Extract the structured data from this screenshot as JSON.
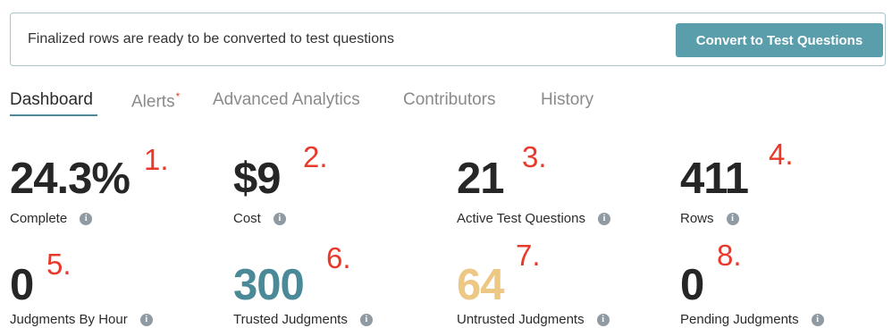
{
  "banner": {
    "message": "Finalized rows are ready to be converted to test questions",
    "button_label": "Convert to Test Questions"
  },
  "tabs": [
    {
      "label": "Dashboard",
      "active": true
    },
    {
      "label": "Alerts",
      "badge": "*"
    },
    {
      "label": "Advanced Analytics"
    },
    {
      "label": "Contributors"
    },
    {
      "label": "History"
    }
  ],
  "stats": [
    {
      "value": "24.3%",
      "label": "Complete",
      "annotation": "1."
    },
    {
      "value": "$9",
      "label": "Cost",
      "annotation": "2."
    },
    {
      "value": "21",
      "label": "Active Test Questions",
      "annotation": "3."
    },
    {
      "value": "411",
      "label": "Rows",
      "annotation": "4."
    },
    {
      "value": "0",
      "label": "Judgments By Hour",
      "annotation": "5."
    },
    {
      "value": "300",
      "label": "Trusted Judgments",
      "annotation": "6.",
      "color": "#4a8a98"
    },
    {
      "value": "64",
      "label": "Untrusted Judgments",
      "annotation": "7.",
      "color": "#edc884"
    },
    {
      "value": "0",
      "label": "Pending Judgments",
      "annotation": "8."
    }
  ],
  "colors": {
    "accent": "#5b9eab",
    "annotation": "#e8392a"
  }
}
